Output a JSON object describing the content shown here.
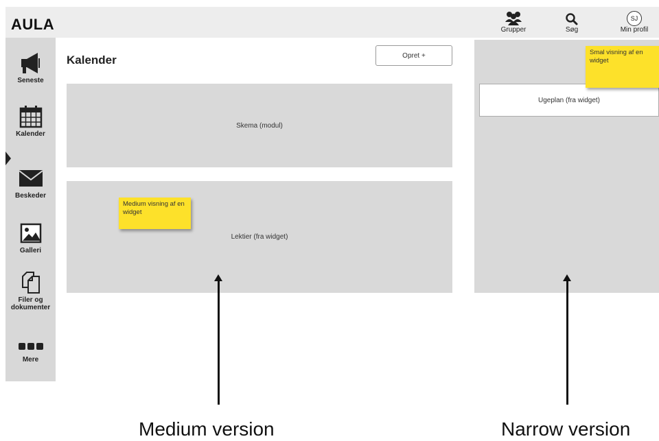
{
  "header": {
    "logo": "AULA",
    "nav": [
      {
        "label": "Grupper",
        "icon": "group-icon"
      },
      {
        "label": "Søg",
        "icon": "search-icon"
      },
      {
        "label": "Min profil",
        "icon": "avatar-icon",
        "initials": "SJ"
      }
    ]
  },
  "sidebar": {
    "items": [
      {
        "label": "Seneste",
        "icon": "megaphone-icon"
      },
      {
        "label": "Kalender",
        "icon": "calendar-icon",
        "active": true
      },
      {
        "label": "Beskeder",
        "icon": "envelope-icon"
      },
      {
        "label": "Galleri",
        "icon": "image-icon"
      },
      {
        "label_line1": "Filer og",
        "label_line2": "dokumenter",
        "icon": "files-icon"
      },
      {
        "label": "Mere",
        "icon": "more-icon"
      }
    ]
  },
  "main": {
    "title": "Kalender",
    "create_button": "Opret +",
    "panels": {
      "schedule": "Skema (modul)",
      "homework": "Lektier (fra widget)"
    },
    "medium_note": "Medium visning af en widget"
  },
  "narrow": {
    "weekplan": "Ugeplan (fra widget)",
    "note": "Smal visning af en widget"
  },
  "captions": {
    "medium": "Medium version",
    "narrow": "Narrow version"
  },
  "colors": {
    "note_yellow": "#fde12a",
    "panel_gray": "#d9d9d9",
    "topbar_gray": "#ededed"
  }
}
